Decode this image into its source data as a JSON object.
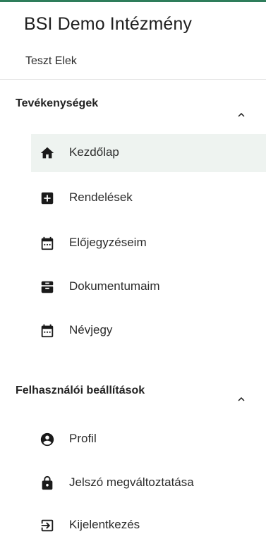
{
  "header": {
    "org_name": "BSI Demo Intézmény",
    "user_name": "Teszt Elek"
  },
  "sections": [
    {
      "title": "Tevékenységek",
      "expanded": true,
      "items": [
        {
          "label": "Kezdőlap",
          "icon": "home-icon",
          "active": true
        },
        {
          "label": "Rendelések",
          "icon": "plus-box-icon",
          "active": false
        },
        {
          "label": "Előjegyzéseim",
          "icon": "calendar-icon",
          "active": false
        },
        {
          "label": "Dokumentumaim",
          "icon": "documents-tray-icon",
          "active": false
        },
        {
          "label": "Névjegy",
          "icon": "calendar-icon",
          "active": false
        }
      ]
    },
    {
      "title": "Felhasználói beállítások",
      "expanded": true,
      "items": [
        {
          "label": "Profil",
          "icon": "account-circle-icon",
          "active": false
        },
        {
          "label": "Jelszó megváltoztatása",
          "icon": "lock-icon",
          "active": false
        },
        {
          "label": "Kijelentkezés",
          "icon": "logout-icon",
          "active": false
        }
      ]
    }
  ],
  "colors": {
    "accent": "#2e7d5b",
    "active_background": "#eef3f0",
    "icon": "#1a1a1a",
    "text": "#2b2b2b"
  }
}
